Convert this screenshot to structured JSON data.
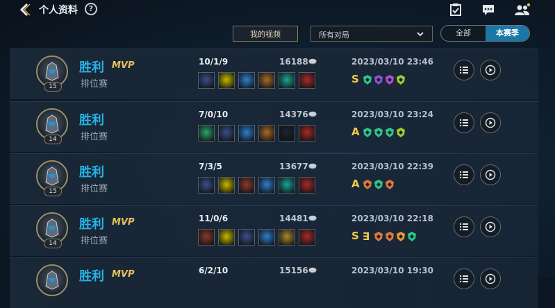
{
  "header": {
    "title": "个人资料",
    "help_icon": "question-icon",
    "right_icons": [
      "checklist-icon",
      "chat-icon",
      "friends-icon"
    ]
  },
  "toolbar": {
    "my_videos_label": "我的视频",
    "mode_select_value": "所有对局",
    "toggle_all_label": "全部",
    "toggle_season_label": "本赛季"
  },
  "matches": [
    {
      "level": "15",
      "result": "胜利",
      "mvp": "MVP",
      "mode": "排位赛",
      "kda": "10/1/9",
      "gold": "16188",
      "date": "2023/03/10 23:46",
      "grade": "S",
      "items": [
        "#3a4f8c",
        "#c7b800",
        "#2d7fd1",
        "#a66a2a",
        "#1aa39a",
        "#a82a2a"
      ],
      "badges": [
        "#2ec28a",
        "#8c4fd8",
        "#b54bd0",
        "#9fc930"
      ]
    },
    {
      "level": "14",
      "result": "胜利",
      "mvp": "",
      "mode": "排位赛",
      "kda": "7/0/10",
      "gold": "14376",
      "date": "2023/03/10 23:24",
      "grade": "A",
      "items": [
        "#2aa36b",
        "#3a4f8c",
        "#2d7fd1",
        "#a66a2a",
        "#1c2530",
        "#a82a2a"
      ],
      "badges": [
        "#2ec28a",
        "#2ec28a",
        "#2ec28a",
        "#9fc930"
      ]
    },
    {
      "level": "15",
      "result": "胜利",
      "mvp": "",
      "mode": "排位赛",
      "kda": "7/3/5",
      "gold": "13677",
      "date": "2023/03/10 22:39",
      "grade": "A",
      "items": [
        "#3a4f8c",
        "#c7b800",
        "#8a3a2e",
        "#2d7fd1",
        "#1aa39a",
        "#a82a2a"
      ],
      "badges": [
        "#d9773a",
        "#2ec28a",
        "#d9773a"
      ]
    },
    {
      "level": "14",
      "result": "胜利",
      "mvp": "MVP",
      "mode": "排位赛",
      "kda": "11/0/6",
      "gold": "14481",
      "date": "2023/03/10 22:18",
      "grade": "S",
      "grade2": "∃",
      "items": [
        "#8a3a2e",
        "#c7b800",
        "#3a4f8c",
        "#2d7fd1",
        "#a68a2a",
        "#a82a2a"
      ],
      "badges": [
        "#d9773a",
        "#d9773a",
        "#e39a2a",
        "#2ec28a"
      ]
    },
    {
      "level": "",
      "result": "胜利",
      "mvp": "MVP",
      "mode": "",
      "kda": "6/2/10",
      "gold": "15156",
      "date": "2023/03/10 19:30",
      "grade": "",
      "items": [],
      "badges": []
    }
  ],
  "row_actions": [
    "list-icon",
    "replay-icon"
  ]
}
